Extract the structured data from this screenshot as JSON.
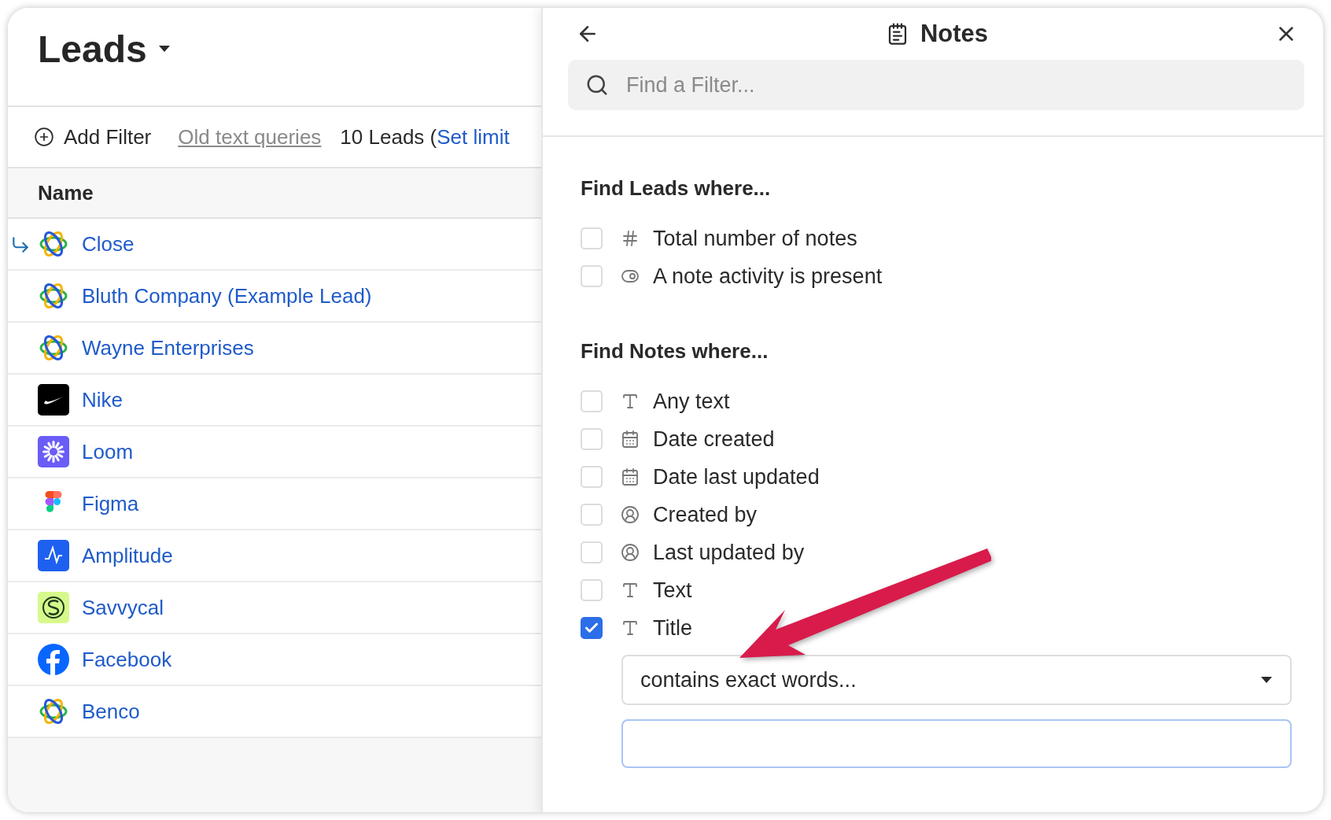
{
  "leads_panel": {
    "title": "Leads",
    "toolbar": {
      "add_filter": "Add Filter",
      "old_queries": "Old text queries",
      "count": "10 Leads (",
      "limit_link": "Set limit"
    },
    "column": "Name",
    "rows": [
      {
        "name": "Close",
        "kind": "orbit",
        "current": true
      },
      {
        "name": "Bluth Company (Example Lead)",
        "kind": "orbit",
        "current": false
      },
      {
        "name": "Wayne Enterprises",
        "kind": "orbit",
        "current": false
      },
      {
        "name": "Nike",
        "kind": "swoosh",
        "current": false
      },
      {
        "name": "Loom",
        "kind": "starburst",
        "current": false
      },
      {
        "name": "Figma",
        "kind": "shapes",
        "current": false
      },
      {
        "name": "Amplitude",
        "kind": "wave",
        "current": false
      },
      {
        "name": "Savvycal",
        "kind": "swirl",
        "current": false
      },
      {
        "name": "Facebook",
        "kind": "letter",
        "current": false
      },
      {
        "name": "Benco",
        "kind": "orbit",
        "current": false
      }
    ]
  },
  "filter_panel": {
    "title": "Notes",
    "search": {
      "placeholder": "Find a Filter..."
    },
    "sections": [
      {
        "heading": "Find Leads where...",
        "filters": [
          {
            "label": "Total number of notes",
            "kind": "number",
            "checked": false
          },
          {
            "label": "A note activity is present",
            "kind": "toggle",
            "checked": false
          }
        ]
      },
      {
        "heading": "Find Notes where...",
        "filters": [
          {
            "label": "Any text",
            "kind": "text",
            "checked": false
          },
          {
            "label": "Date created",
            "kind": "date",
            "checked": false
          },
          {
            "label": "Date last updated",
            "kind": "date",
            "checked": false
          },
          {
            "label": "Created by",
            "kind": "person",
            "checked": false
          },
          {
            "label": "Last updated by",
            "kind": "person",
            "checked": false
          },
          {
            "label": "Text",
            "kind": "text",
            "checked": false
          },
          {
            "label": "Title",
            "kind": "text",
            "checked": true,
            "condition": {
              "operator": "contains exact words..."
            }
          }
        ]
      }
    ]
  }
}
